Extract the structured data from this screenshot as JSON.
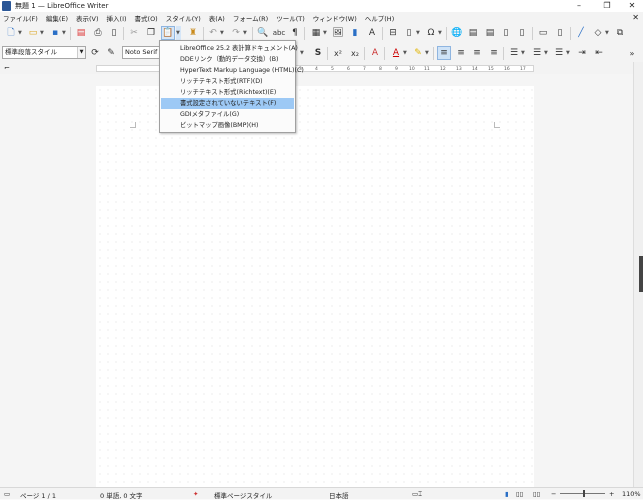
{
  "window": {
    "title": "無題 1 — LibreOffice Writer",
    "controls": [
      "–",
      "❐",
      "✕"
    ]
  },
  "menubar": {
    "items": [
      "ファイル(F)",
      "編集(E)",
      "表示(V)",
      "挿入(I)",
      "書式(O)",
      "スタイル(Y)",
      "表(A)",
      "フォーム(R)",
      "ツール(T)",
      "ウィンドウ(W)",
      "ヘルプ(H)"
    ],
    "close_doc": "✕"
  },
  "toolbar": {
    "paragraph_style": "標準段落スタイル",
    "font_name": "Noto Serif JP"
  },
  "ruler": {
    "ticks": [
      "1",
      "2",
      "3",
      "4",
      "5",
      "6",
      "7",
      "8",
      "9",
      "10",
      "11",
      "12",
      "13",
      "14",
      "15",
      "16",
      "17"
    ]
  },
  "paste_special_menu": {
    "items": [
      "LibreOffice 25.2 表計算ドキュメント(A)",
      "DDEリンク（動的データ交換）(B)",
      "HyperText Markup Language (HTML)(C)",
      "リッチテキスト形式(RTF)(D)",
      "リッチテキスト形式(Richtext)(E)",
      "書式設定されていないテキスト(F)",
      "GDIメタファイル(G)",
      "ビットマップ画像(BMP)(H)"
    ],
    "selected_index": 5
  },
  "statusbar": {
    "page": "ページ 1 / 1",
    "word_count": "0 単語, 0 文字",
    "page_style": "標準ページスタイル",
    "language": "日本語",
    "zoom": "110%"
  },
  "colors": {
    "menu_highlight": "#9dc9f5",
    "accent_blue": "#2a6fc6"
  }
}
